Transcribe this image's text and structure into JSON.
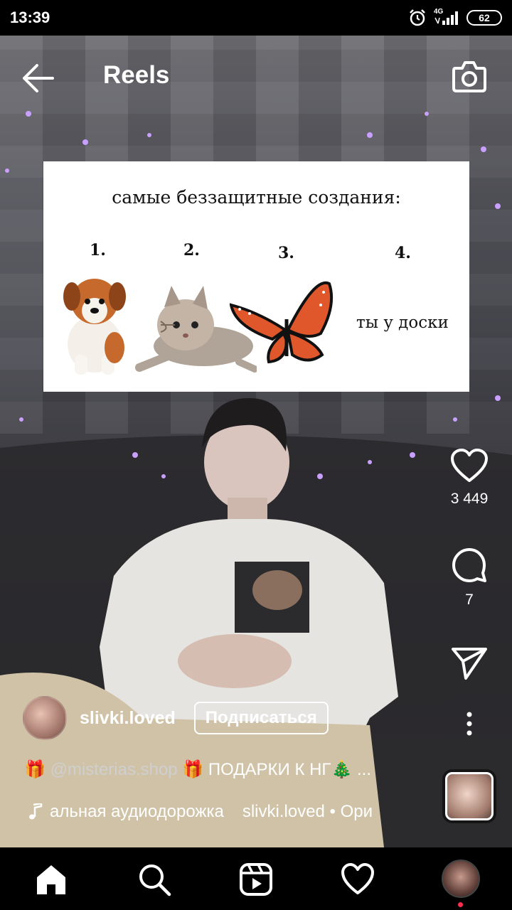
{
  "status_bar": {
    "time": "13:39",
    "network": "4G",
    "battery": "62"
  },
  "header": {
    "title": "Reels"
  },
  "meme": {
    "title": "самые беззащитные создания:",
    "items": [
      {
        "number": "1.",
        "icon": "puppy-icon"
      },
      {
        "number": "2.",
        "icon": "kitten-icon"
      },
      {
        "number": "3.",
        "icon": "butterfly-icon"
      },
      {
        "number": "4.",
        "text": "ты у доски"
      }
    ]
  },
  "actions": {
    "likes": "3 449",
    "comments": "7"
  },
  "author": {
    "username": "slivki.loved",
    "follow_label": "Подписаться"
  },
  "caption": {
    "gift_emoji": "🎁",
    "mention": "@misterias.shop",
    "text": "ПОДАРКИ К НГ",
    "tree_emoji": "🎄",
    "more": "..."
  },
  "audio": {
    "track": "альная аудиодорожка",
    "artist": "slivki.loved • Ори"
  },
  "colors": {
    "background": "#000000",
    "text": "#ffffff",
    "notification_dot": "#ff2e4d"
  }
}
